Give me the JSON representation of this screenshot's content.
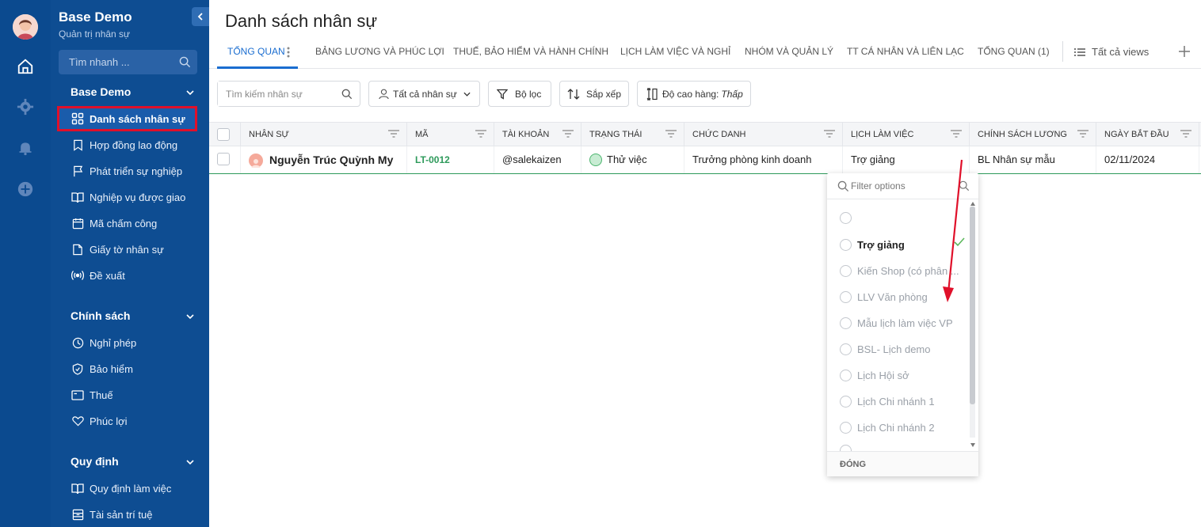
{
  "sidebar": {
    "title": "Base Demo",
    "subtitle": "Quản trị nhân sự",
    "search_placeholder": "Tìm nhanh ...",
    "sections": [
      {
        "label": "Base Demo",
        "items": [
          "Danh sách nhân sự",
          "Hợp đồng lao động",
          "Phát triển sự nghiệp",
          "Nghiệp vụ được giao",
          "Mã chấm công",
          "Giấy tờ nhân sự",
          "Đề xuất"
        ]
      },
      {
        "label": "Chính sách",
        "items": [
          "Nghỉ phép",
          "Bảo hiểm",
          "Thuế",
          "Phúc lợi"
        ]
      },
      {
        "label": "Quy định",
        "items": [
          "Quy định làm việc",
          "Tài sản trí tuệ"
        ]
      }
    ]
  },
  "page": {
    "title": "Danh sách nhân sự"
  },
  "tabs": [
    "TỔNG QUAN",
    "BẢNG LƯƠNG VÀ PHÚC LỢI",
    "THUẾ, BẢO HIỂM VÀ HÀNH CHÍNH",
    "LỊCH LÀM VIỆC VÀ NGHỈ",
    "NHÓM VÀ QUẢN LÝ",
    "TT CÁ NHÂN VÀ LIÊN LẠC",
    "TỔNG QUAN (1)"
  ],
  "views_label": "Tất cả views",
  "toolbar": {
    "search_placeholder": "Tìm kiếm nhân sự",
    "scope": "Tất cả nhân sự",
    "filter": "Bộ lọc",
    "sort": "Sắp xếp",
    "row_height_label": "Độ cao hàng:",
    "row_height_value": "Thấp"
  },
  "table": {
    "columns": [
      "NHÂN SỰ",
      "MÃ",
      "TÀI KHOẢN",
      "TRẠNG THÁI",
      "CHỨC DANH",
      "LỊCH LÀM VIỆC",
      "CHÍNH SÁCH LƯƠNG",
      "NGÀY BẮT ĐẦU"
    ],
    "rows": [
      {
        "name": "Nguyễn Trúc Quỳnh My",
        "code": "LT-0012",
        "account": "@salekaizen",
        "status": "Thử việc",
        "title": "Trưởng phòng kinh doanh",
        "schedule": "Trợ giảng",
        "salary_policy": "BL Nhân sự mẫu",
        "start_date": "02/11/2024"
      }
    ]
  },
  "dropdown": {
    "search_placeholder": "Filter options",
    "options": [
      "",
      "Trợ giảng",
      "Kiến Shop (có phân ...",
      "LLV Văn phòng",
      "Mẫu lịch làm việc VP",
      "BSL- Lịch demo",
      "Lịch Hội sở",
      "Lịch Chi nhánh 1",
      "Lịch Chi nhánh 2"
    ],
    "selected_index": 1,
    "footer": "ĐÓNG"
  },
  "colors": {
    "sidebar": "#0e4d92",
    "accent": "#1a6dd0",
    "highlight": "#e0102a",
    "code": "#2e9a5b"
  }
}
